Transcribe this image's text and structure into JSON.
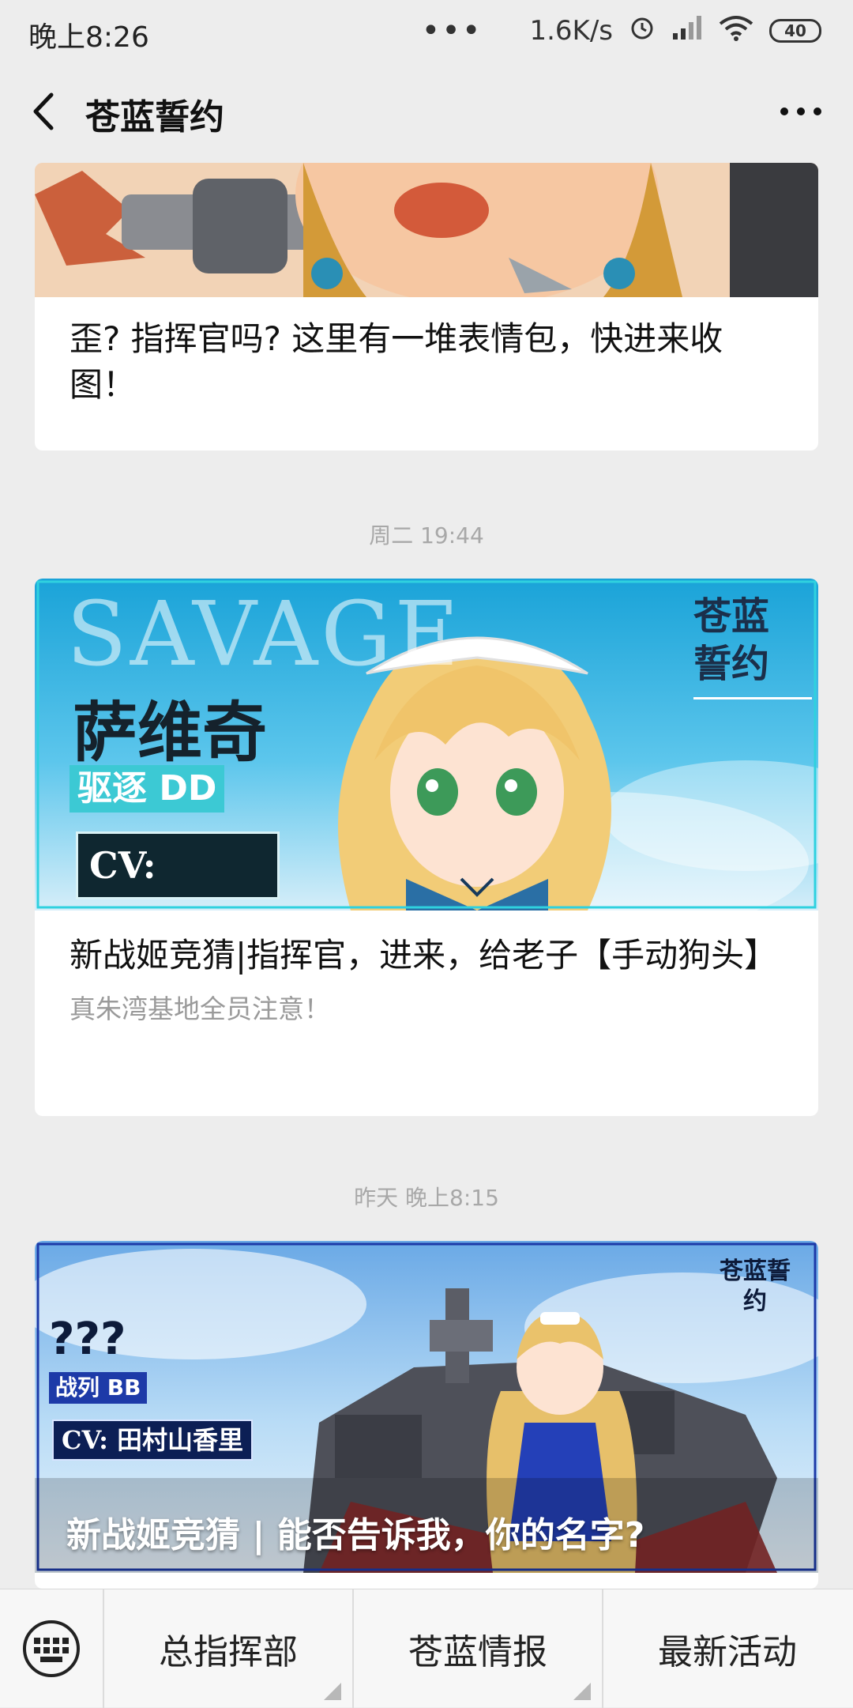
{
  "status_bar": {
    "time": "晚上8:26",
    "dots": "•••",
    "network_speed": "1.6K/s",
    "battery": "40",
    "icons": [
      "alarm-icon",
      "signal-icon",
      "wifi-icon",
      "battery-icon"
    ]
  },
  "header": {
    "title": "苍蓝誓约"
  },
  "feed": {
    "articles": [
      {
        "title": "歪? 指挥官吗? 这里有一堆表情包，快进来收图！"
      },
      {
        "timestamp": "周二 19:44",
        "title": "新战姬竞猜|指挥官，进来，给老子【手动狗头】",
        "subtitle": "真朱湾基地全员注意！",
        "banner": {
          "bg_text": "SAVAGE",
          "ship_name": "萨维奇",
          "ship_class": "驱逐 DD",
          "cv": "CV: ？？？",
          "logo": "苍蓝誓约"
        }
      },
      {
        "timestamp": "昨天 晚上8:15",
        "title": "新战姬竞猜 | 能否告诉我，你的名字?",
        "banner": {
          "ship_name": "???",
          "ship_class": "战列 BB",
          "cv": "CV: 田村山香里",
          "logo": "苍蓝誓约"
        }
      }
    ]
  },
  "bottom_menu": {
    "items": [
      "总指挥部",
      "苍蓝情报",
      "最新活动"
    ]
  },
  "colors": {
    "background": "#ededed",
    "card": "#ffffff",
    "timestamp": "#a8a8a8"
  }
}
